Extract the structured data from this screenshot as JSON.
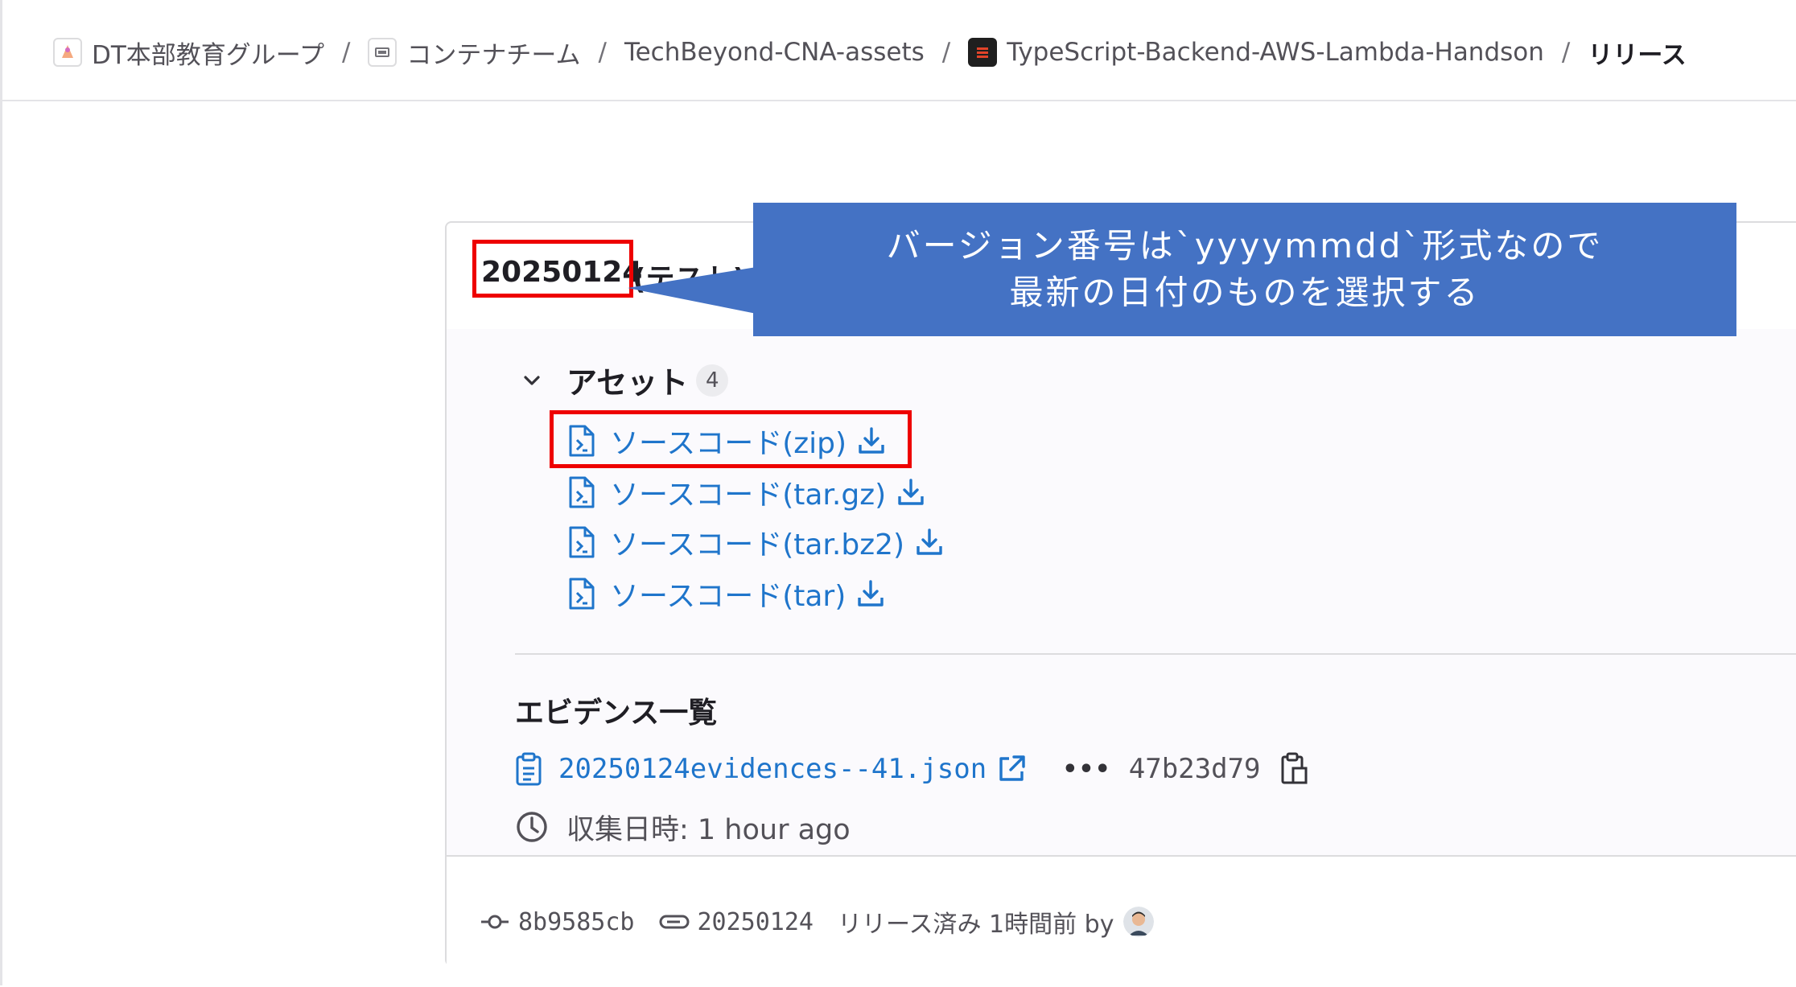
{
  "breadcrumb": {
    "items": [
      {
        "label": "DT本部教育グループ",
        "icon": "group-avatar-icon"
      },
      {
        "label": "コンテナチーム",
        "icon": "subgroup-avatar-icon"
      },
      {
        "label": "TechBeyond-CNA-assets",
        "icon": ""
      },
      {
        "label": "TypeScript-Backend-AWS-Lambda-Handson",
        "icon": "project-avatar-icon"
      },
      {
        "label": "リリース",
        "icon": ""
      }
    ],
    "separator": "/"
  },
  "release": {
    "version": "20250124",
    "title_suffix": "(テスト)"
  },
  "callout": {
    "line1": "バージョン番号は`yyyymmdd`形式なので",
    "line2": "最新の日付のものを選択する",
    "color": "#4472c4"
  },
  "assets": {
    "title": "アセット",
    "count": "4",
    "items": [
      {
        "label": "ソースコード(zip)"
      },
      {
        "label": "ソースコード(tar.gz)"
      },
      {
        "label": "ソースコード(tar.bz2)"
      },
      {
        "label": "ソースコード(tar)"
      }
    ]
  },
  "evidence": {
    "title": "エビデンス一覧",
    "file": "20250124evidences--41.json",
    "more": "•••",
    "sha": "47b23d79",
    "collected": "収集日時: 1 hour ago"
  },
  "footer": {
    "commit": "8b9585cb",
    "tag": "20250124",
    "released": "リリース済み 1時間前 by"
  },
  "colors": {
    "link": "#1f75cb",
    "highlight": "#ee0000"
  }
}
